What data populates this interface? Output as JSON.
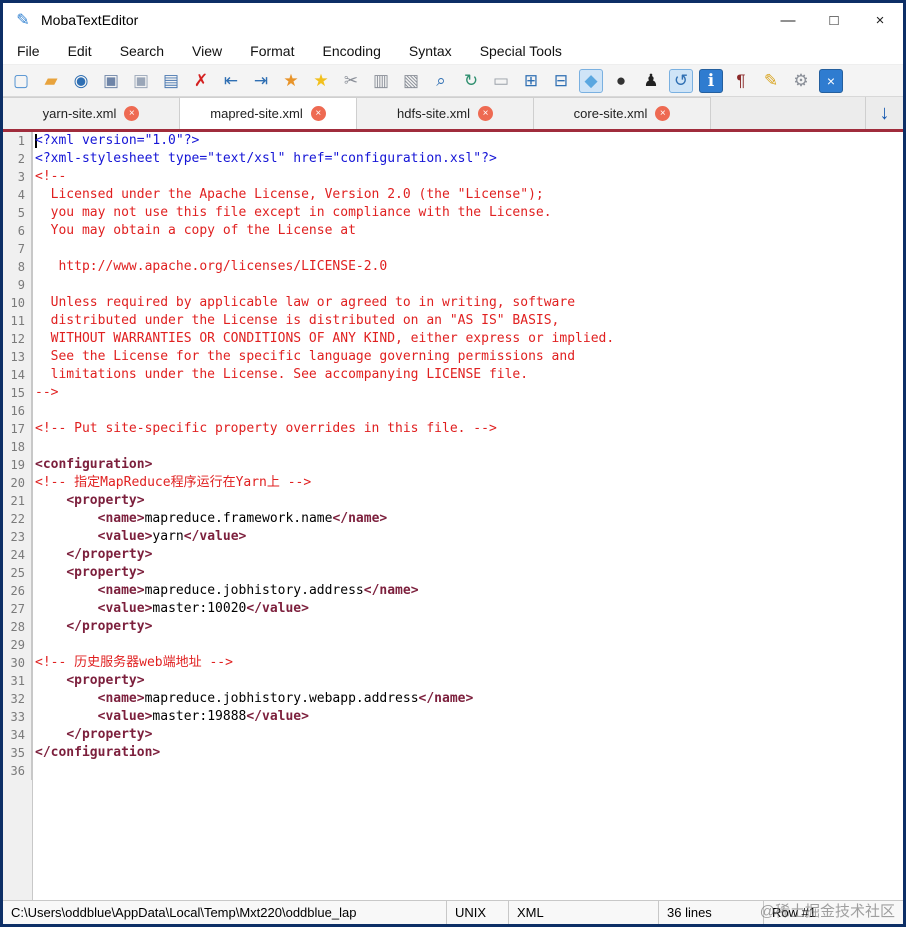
{
  "window": {
    "title": "MobaTextEditor",
    "icon_glyph": "✎",
    "minimize_label": "—",
    "maximize_label": "□",
    "close_label": "×"
  },
  "menu": {
    "items": [
      "File",
      "Edit",
      "Search",
      "View",
      "Format",
      "Encoding",
      "Syntax",
      "Special Tools"
    ]
  },
  "toolbar": {
    "icons": [
      {
        "name": "new-file-icon",
        "glyph": "▢",
        "color": "#4d8fd0"
      },
      {
        "name": "open-folder-icon",
        "glyph": "▰",
        "color": "#e8a33d"
      },
      {
        "name": "record-icon",
        "glyph": "◉",
        "color": "#2f6fb3"
      },
      {
        "name": "save-icon",
        "glyph": "▣",
        "color": "#6f85a8"
      },
      {
        "name": "save-all-icon",
        "glyph": "▣",
        "color": "#9aa6b8"
      },
      {
        "name": "print-icon",
        "glyph": "▤",
        "color": "#4a78b0"
      },
      {
        "name": "delete-icon",
        "glyph": "✗",
        "color": "#d42020"
      },
      {
        "name": "outdent-icon",
        "glyph": "⇤",
        "color": "#2f6fb3"
      },
      {
        "name": "indent-icon",
        "glyph": "⇥",
        "color": "#2f6fb3"
      },
      {
        "name": "favorite-add-icon",
        "glyph": "★",
        "color": "#e8942a"
      },
      {
        "name": "favorite-icon",
        "glyph": "★",
        "color": "#f2c01d"
      },
      {
        "name": "cut-icon",
        "glyph": "✂",
        "color": "#8a8f98"
      },
      {
        "name": "copy-icon",
        "glyph": "▥",
        "color": "#8a8f98"
      },
      {
        "name": "paste-icon",
        "glyph": "▧",
        "color": "#8a8f98"
      },
      {
        "name": "search-icon",
        "glyph": "⌕",
        "color": "#2f6fb3"
      },
      {
        "name": "replace-icon",
        "glyph": "↻",
        "color": "#2f8f6f"
      },
      {
        "name": "frame-icon",
        "glyph": "▭",
        "color": "#9aa0a8"
      },
      {
        "name": "split-view-icon",
        "glyph": "⊞",
        "color": "#2f6fb3"
      },
      {
        "name": "sync-view-icon",
        "glyph": "⊟",
        "color": "#2f6fb3"
      },
      {
        "name": "water-drop-icon",
        "glyph": "◆",
        "color": "#5aa7e0",
        "state": "active"
      },
      {
        "name": "apple-icon",
        "glyph": "●",
        "color": "#333333"
      },
      {
        "name": "linux-penguin-icon",
        "glyph": "♟",
        "color": "#222222"
      },
      {
        "name": "undo-icon",
        "glyph": "↺",
        "color": "#2f6fb3",
        "state": "active"
      },
      {
        "name": "info-icon",
        "glyph": "ℹ",
        "color": "#ffffff",
        "state": "active-solid"
      },
      {
        "name": "pilcrow-icon",
        "glyph": "¶",
        "color": "#8b2a2a"
      },
      {
        "name": "highlighter-icon",
        "glyph": "✎",
        "color": "#d9a521"
      },
      {
        "name": "settings-gears-icon",
        "glyph": "⚙",
        "color": "#8a8f98"
      },
      {
        "name": "close-editor-icon",
        "glyph": "×",
        "color": "#ffffff",
        "state": "solid-blue"
      }
    ]
  },
  "tabbar": {
    "tabs": [
      {
        "label": "yarn-site.xml",
        "active": false
      },
      {
        "label": "mapred-site.xml",
        "active": true
      },
      {
        "label": "hdfs-site.xml",
        "active": false
      },
      {
        "label": "core-site.xml",
        "active": false
      }
    ],
    "close_glyph": "×",
    "scroll_down_icon": "↓"
  },
  "editor": {
    "caret_line": 1,
    "lines": [
      [
        {
          "c": "proc",
          "t": "<?xml version=\"1.0\"?>"
        }
      ],
      [
        {
          "c": "proc",
          "t": "<?xml-stylesheet type=\"text/xsl\" href=\"configuration.xsl\"?>"
        }
      ],
      [
        {
          "c": "comment",
          "t": "<!--"
        }
      ],
      [
        {
          "c": "comment",
          "t": "  Licensed under the Apache License, Version 2.0 (the \"License\");"
        }
      ],
      [
        {
          "c": "comment",
          "t": "  you may not use this file except in compliance with the License."
        }
      ],
      [
        {
          "c": "comment",
          "t": "  You may obtain a copy of the License at"
        }
      ],
      [],
      [
        {
          "c": "comment",
          "t": "   http://www.apache.org/licenses/LICENSE-2.0"
        }
      ],
      [],
      [
        {
          "c": "comment",
          "t": "  Unless required by applicable law or agreed to in writing, software"
        }
      ],
      [
        {
          "c": "comment",
          "t": "  distributed under the License is distributed on an \"AS IS\" BASIS,"
        }
      ],
      [
        {
          "c": "comment",
          "t": "  WITHOUT WARRANTIES OR CONDITIONS OF ANY KIND, either express or implied."
        }
      ],
      [
        {
          "c": "comment",
          "t": "  See the License for the specific language governing permissions and"
        }
      ],
      [
        {
          "c": "comment",
          "t": "  limitations under the License. See accompanying LICENSE file."
        }
      ],
      [
        {
          "c": "comment",
          "t": "-->"
        }
      ],
      [],
      [
        {
          "c": "comment",
          "t": "<!-- Put site-specific property overrides in this file. -->"
        }
      ],
      [],
      [
        {
          "c": "tag",
          "t": "<configuration>"
        }
      ],
      [
        {
          "c": "comment",
          "t": "<!-- 指定MapReduce程序运行在Yarn上 -->"
        }
      ],
      [
        {
          "c": "plain",
          "t": "    "
        },
        {
          "c": "tag",
          "t": "<property>"
        }
      ],
      [
        {
          "c": "plain",
          "t": "        "
        },
        {
          "c": "tag",
          "t": "<name>"
        },
        {
          "c": "plain",
          "t": "mapreduce.framework.name"
        },
        {
          "c": "tag",
          "t": "</name>"
        }
      ],
      [
        {
          "c": "plain",
          "t": "        "
        },
        {
          "c": "tag",
          "t": "<value>"
        },
        {
          "c": "plain",
          "t": "yarn"
        },
        {
          "c": "tag",
          "t": "</value>"
        }
      ],
      [
        {
          "c": "plain",
          "t": "    "
        },
        {
          "c": "tag",
          "t": "</property>"
        }
      ],
      [
        {
          "c": "plain",
          "t": "    "
        },
        {
          "c": "tag",
          "t": "<property>"
        }
      ],
      [
        {
          "c": "plain",
          "t": "        "
        },
        {
          "c": "tag",
          "t": "<name>"
        },
        {
          "c": "plain",
          "t": "mapreduce.jobhistory.address"
        },
        {
          "c": "tag",
          "t": "</name>"
        }
      ],
      [
        {
          "c": "plain",
          "t": "        "
        },
        {
          "c": "tag",
          "t": "<value>"
        },
        {
          "c": "plain",
          "t": "master:10020"
        },
        {
          "c": "tag",
          "t": "</value>"
        }
      ],
      [
        {
          "c": "plain",
          "t": "    "
        },
        {
          "c": "tag",
          "t": "</property>"
        }
      ],
      [],
      [
        {
          "c": "comment",
          "t": "<!-- 历史服务器web端地址 -->"
        }
      ],
      [
        {
          "c": "plain",
          "t": "    "
        },
        {
          "c": "tag",
          "t": "<property>"
        }
      ],
      [
        {
          "c": "plain",
          "t": "        "
        },
        {
          "c": "tag",
          "t": "<name>"
        },
        {
          "c": "plain",
          "t": "mapreduce.jobhistory.webapp.address"
        },
        {
          "c": "tag",
          "t": "</name>"
        }
      ],
      [
        {
          "c": "plain",
          "t": "        "
        },
        {
          "c": "tag",
          "t": "<value>"
        },
        {
          "c": "plain",
          "t": "master:19888"
        },
        {
          "c": "tag",
          "t": "</value>"
        }
      ],
      [
        {
          "c": "plain",
          "t": "    "
        },
        {
          "c": "tag",
          "t": "</property>"
        }
      ],
      [
        {
          "c": "tag",
          "t": "</configuration>"
        }
      ],
      []
    ]
  },
  "statusbar": {
    "file_path": "C:\\Users\\oddblue\\AppData\\Local\\Temp\\Mxt220\\oddblue_lap",
    "line_ending": "UNIX",
    "syntax": "XML",
    "line_count": "36 lines",
    "cursor_row": "Row #1",
    "watermark": "@稀土掘金技术社区"
  },
  "colors": {
    "xml_proc": "#1515d6",
    "xml_comment": "#e02020",
    "xml_tag": "#7c1f3c",
    "plain": "#000000",
    "accent_blue": "#1b5fb5"
  }
}
